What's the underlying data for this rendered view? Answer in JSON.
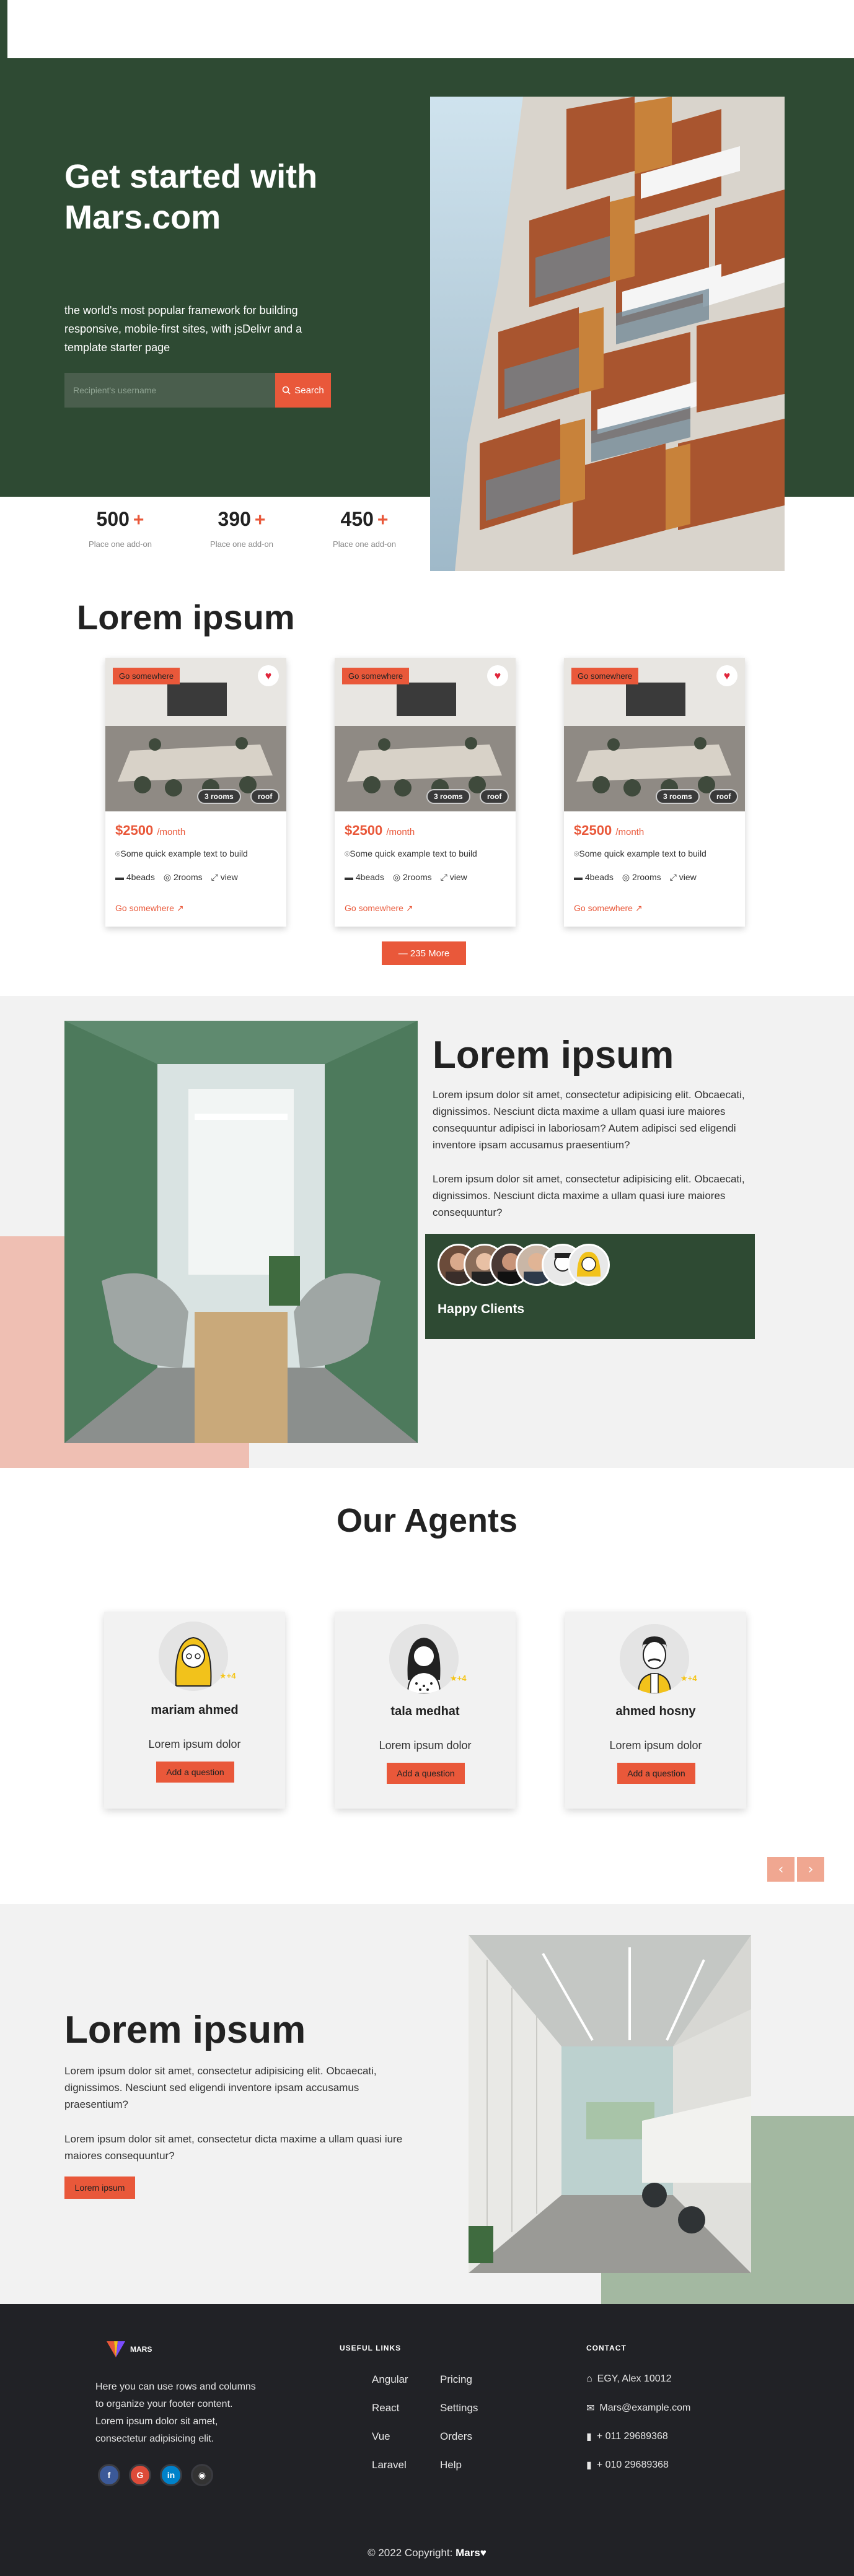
{
  "hero": {
    "title": "Get started with Mars.com",
    "subtitle": "the world's most popular framework for building responsive, mobile-first sites, with jsDelivr and a template starter page",
    "search_placeholder": "Recipient's username",
    "search_button": "Search"
  },
  "stats": [
    {
      "value": "500",
      "plus": "+",
      "label": "Place one add-on"
    },
    {
      "value": "390",
      "plus": "+",
      "label": "Place one add-on"
    },
    {
      "value": "450",
      "plus": "+",
      "label": "Place one add-on"
    }
  ],
  "listings": {
    "title": "Lorem ipsum",
    "cards": [
      {
        "tag": "Go somewhere",
        "rooms_pill": "3 rooms",
        "roof_pill": "roof",
        "price": "$2500",
        "per": "/month",
        "address": "Some quick example text to build",
        "beds": "4beads",
        "rooms": "2rooms",
        "view": "view",
        "link": "Go somewhere ↗"
      },
      {
        "tag": "Go somewhere",
        "rooms_pill": "3 rooms",
        "roof_pill": "roof",
        "price": "$2500",
        "per": "/month",
        "address": "Some quick example text to build",
        "beds": "4beads",
        "rooms": "2rooms",
        "view": "view",
        "link": "Go somewhere ↗"
      },
      {
        "tag": "Go somewhere",
        "rooms_pill": "3 rooms",
        "roof_pill": "roof",
        "price": "$2500",
        "per": "/month",
        "address": "Some quick example text to build",
        "beds": "4beads",
        "rooms": "2rooms",
        "view": "view",
        "link": "Go somewhere ↗"
      }
    ],
    "more_button": "— 235 More"
  },
  "about": {
    "title": "Lorem ipsum",
    "p1": "Lorem ipsum dolor sit amet, consectetur adipisicing elit. Obcaecati, dignissimos. Nesciunt dicta maxime a ullam quasi iure maiores consequuntur adipisci in laboriosam? Autem adipisci sed eligendi inventore ipsam accusamus praesentium?",
    "p2": "Lorem ipsum dolor sit amet, consectetur adipisicing elit. Obcaecati, dignissimos. Nesciunt dicta maxime a ullam quasi iure maiores consequuntur?",
    "clients_label": "Happy Clients"
  },
  "agents": {
    "title": "Our Agents",
    "list": [
      {
        "name": "mariam ahmed",
        "rating": "+4",
        "desc": "Lorem ipsum dolor",
        "button": "Add a question"
      },
      {
        "name": "tala medhat",
        "rating": "+4",
        "desc": "Lorem ipsum dolor",
        "button": "Add a question"
      },
      {
        "name": "ahmed hosny",
        "rating": "+4",
        "desc": "Lorem ipsum dolor",
        "button": "Add a question"
      }
    ],
    "prev": "‹",
    "next": "›"
  },
  "office": {
    "title": "Lorem ipsum",
    "p1": "Lorem ipsum dolor sit amet, consectetur adipisicing elit. Obcaecati, dignissimos. Nesciunt sed eligendi inventore ipsam accusamus praesentium?",
    "p2": "Lorem ipsum dolor sit amet, consectetur dicta maxime a ullam quasi iure maiores consequuntur?",
    "button": "Lorem ipsum"
  },
  "footer": {
    "brand": "MARS",
    "about": "Here you can use rows and columns to organize your footer content. Lorem ipsum dolor sit amet, consectetur adipisicing elit.",
    "useful_links_heading": "USEFUL LINKS",
    "links_col1": [
      "Angular",
      "React",
      "Vue",
      "Laravel"
    ],
    "links_col2": [
      "Pricing",
      "Settings",
      "Orders",
      "Help"
    ],
    "contact_heading": "CONTACT",
    "contact": [
      {
        "icon": "home-icon",
        "text": "EGY, Alex 10012"
      },
      {
        "icon": "mail-icon",
        "text": "Mars@example.com"
      },
      {
        "icon": "phone-icon",
        "text": "+ 011 29689368"
      },
      {
        "icon": "phone-icon",
        "text": "+ 010 29689368"
      }
    ],
    "socials": [
      {
        "icon": "facebook-icon",
        "glyph": "f",
        "color": "#3b5998"
      },
      {
        "icon": "google-icon",
        "glyph": "G",
        "color": "#dd4b39"
      },
      {
        "icon": "linkedin-icon",
        "glyph": "in",
        "color": "#0082ca"
      },
      {
        "icon": "github-icon",
        "glyph": "◉",
        "color": "#333333"
      }
    ],
    "copyright": "© 2022 Copyright:",
    "copyright_brand": "Mars♥"
  },
  "colors": {
    "accent": "#e9583a",
    "dark_green": "#2e4a33",
    "footer_bg": "#212226",
    "pink_block": "#efbfb3",
    "sage_block": "#a3b8a1"
  }
}
